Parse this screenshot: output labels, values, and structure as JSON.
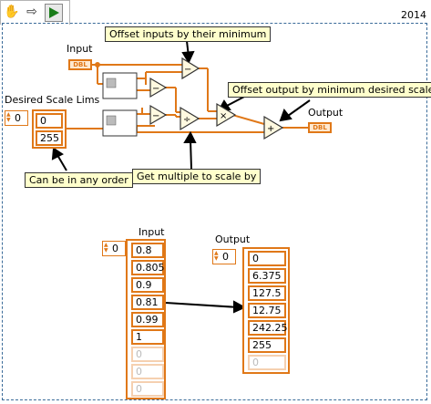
{
  "year": "2014",
  "labels": {
    "input": "Input",
    "desired": "Desired Scale Lims",
    "output": "Output",
    "array_input": "Input",
    "array_output": "Output"
  },
  "notes": {
    "offset_inputs": "Offset inputs by their minimum",
    "offset_output": "Offset output by minimum desired scale",
    "any_order": "Can be in any order",
    "multiple": "Get multiple to scale by"
  },
  "terminals": {
    "dbl": "DBL"
  },
  "desired_lims": {
    "index": "0",
    "values": [
      "0",
      "255"
    ]
  },
  "input_array": {
    "index": "0",
    "values": [
      "0.8",
      "0.805",
      "0.9",
      "0.81",
      "0.99",
      "1",
      "0",
      "0",
      "0"
    ]
  },
  "output_array": {
    "index": "0",
    "values": [
      "0",
      "6.375",
      "127.5",
      "12.75",
      "242.25",
      "255",
      "0"
    ]
  },
  "colors": {
    "wire": "#e07818",
    "note_bg": "#ffffcc",
    "frame": "#3a6b99"
  }
}
